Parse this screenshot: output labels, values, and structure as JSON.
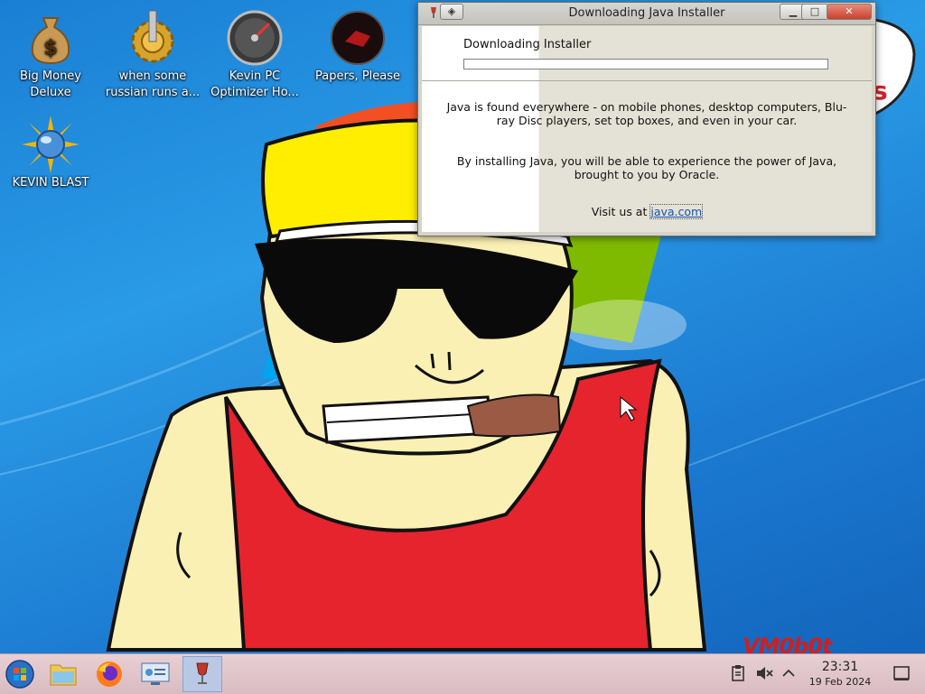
{
  "desktop": {
    "icons": [
      {
        "name": "money-bag-icon",
        "label_line1": "Big Money",
        "label_line2": "Deluxe"
      },
      {
        "name": "gear-icon",
        "label_line1": "when some",
        "label_line2": "russian runs a..."
      },
      {
        "name": "speedometer-icon",
        "label_line1": "Kevin PC",
        "label_line2": "Optimizer Ho..."
      },
      {
        "name": "papers-please-icon",
        "label_line1": "Papers, Please",
        "label_line2": ""
      },
      {
        "name": "sun-globe-icon",
        "label_line1": "KEVIN BLAST",
        "label_line2": ""
      }
    ],
    "watermark": "VM0b0t"
  },
  "java_window": {
    "title": "Downloading Java Installer",
    "buttons": {
      "minimize": "▁",
      "maximize": "□",
      "close": "✕"
    },
    "status_label": "Downloading Installer",
    "progress_fraction": 0.0,
    "paragraph1": "Java is found everywhere - on mobile phones, desktop computers, Blu-ray Disc players, set top boxes, and even in your car.",
    "paragraph2": "By installing Java, you will be able to experience the power of Java, brought to you by Oracle.",
    "visit_prefix": "Visit us at ",
    "visit_link": "java.com"
  },
  "taskbar": {
    "buttons": [
      "start-orb-icon",
      "file-manager-icon",
      "firefox-icon",
      "remote-desktop-icon",
      "java-installer-icon"
    ],
    "tray": [
      "clipboard-icon",
      "volume-muted-icon",
      "chevron-up-icon"
    ],
    "time": "23:31",
    "date": "19 Feb 2024",
    "show_desktop": "show-desktop-icon"
  },
  "colors": {
    "desktop_blue": "#1a7fd4",
    "taskbar_pink": "#e3c6cb",
    "progress_blue": "#3c8fd9",
    "link_blue": "#1553b0"
  }
}
